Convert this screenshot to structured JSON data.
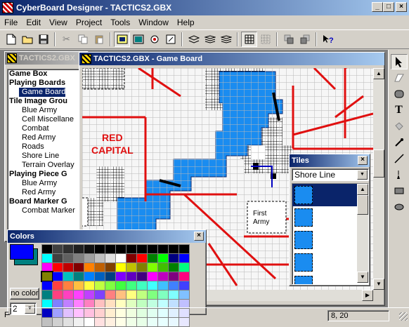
{
  "app": {
    "title": "CyberBoard Designer - TACTICS2.GBX"
  },
  "menu": [
    "File",
    "Edit",
    "View",
    "Project",
    "Tools",
    "Window",
    "Help"
  ],
  "toolbar": {
    "icons": [
      "new-file-icon",
      "open-folder-icon",
      "save-icon",
      "cut-icon",
      "copy-icon",
      "paste-icon",
      "board-view-icon",
      "tile-palette-icon",
      "rotate-icon",
      "edit-icon",
      "layer-1-icon",
      "layer-2-icon",
      "layer-3-icon",
      "grid-icon",
      "dotted-grid-icon",
      "stack-icon",
      "stack-alt-icon",
      "help-pointer-icon"
    ]
  },
  "project_window": {
    "title": "TACTICS2.GBX",
    "tree": [
      {
        "label": "Game Box",
        "level": 0
      },
      {
        "label": "Playing Boards",
        "level": 0
      },
      {
        "label": "Game Board",
        "level": 1,
        "selected": true
      },
      {
        "label": "Tile Image Grou",
        "level": 0
      },
      {
        "label": "Blue Army",
        "level": 1
      },
      {
        "label": "Cell Miscellane",
        "level": 1
      },
      {
        "label": "Combat",
        "level": 1
      },
      {
        "label": "Red Army",
        "level": 1
      },
      {
        "label": "Roads",
        "level": 1
      },
      {
        "label": "Shore Line",
        "level": 1
      },
      {
        "label": "Terrain Overlay",
        "level": 1
      },
      {
        "label": "Playing Piece G",
        "level": 0
      },
      {
        "label": "Blue Army",
        "level": 1
      },
      {
        "label": "Red Army",
        "level": 1
      },
      {
        "label": "Board Marker G",
        "level": 0
      },
      {
        "label": "Combat Marker",
        "level": 1
      }
    ]
  },
  "board_window": {
    "title": "TACTICS2.GBX - Game Board",
    "labels": {
      "red_capital_1": "RED",
      "red_capital_2": "CAPITAL",
      "first_army_1": "First",
      "first_army_2": "Army"
    }
  },
  "tiles_window": {
    "title": "Tiles",
    "selected_group": "Shore Line",
    "tile_count": 5
  },
  "colors_window": {
    "title": "Colors",
    "no_color_label": "no color",
    "line_width": "2",
    "foreground": "#0000ff",
    "background": "#008080",
    "palette": [
      [
        "#000000",
        "#404040",
        "#303030",
        "#202020",
        "#101010",
        "#000000",
        "#000000",
        "#000000",
        "#000000",
        "#000000",
        "#000000",
        "#000000",
        "#000000",
        "#000000"
      ],
      [
        "#00ffff",
        "#404040",
        "#606060",
        "#808080",
        "#a0a0a0",
        "#c0c0c0",
        "#e0e0e0",
        "#ffffff",
        "#800000",
        "#ff0000",
        "#008000",
        "#00ff00",
        "#000080",
        "#0000ff"
      ],
      [
        "#ff00ff",
        "#ff0000",
        "#c00000",
        "#800000",
        "#ff8000",
        "#c06000",
        "#804000",
        "#ffff00",
        "#c0c000",
        "#808000",
        "#80ff00",
        "#40c000",
        "#008000",
        "#00ff80"
      ],
      [
        "#808000",
        "#0000ff",
        "#00c0c0",
        "#008080",
        "#0080ff",
        "#0060c0",
        "#004080",
        "#8000ff",
        "#6000c0",
        "#400080",
        "#ff00ff",
        "#c000c0",
        "#800080",
        "#ff0080"
      ],
      [
        "#0000ff",
        "#ff4040",
        "#ff8040",
        "#ffc040",
        "#ffff40",
        "#c0ff40",
        "#80ff40",
        "#40ff40",
        "#40ff80",
        "#40ffc0",
        "#40ffff",
        "#40c0ff",
        "#4080ff",
        "#4040ff"
      ],
      [
        "#008080",
        "#ff4080",
        "#ff40c0",
        "#ff40ff",
        "#c040ff",
        "#8040ff",
        "#ff8080",
        "#ffc080",
        "#ffff80",
        "#c0ff80",
        "#80ff80",
        "#80ffc0",
        "#80ffff",
        "#80c0ff"
      ],
      [
        "#00ffff",
        "#8080ff",
        "#c080ff",
        "#ff80ff",
        "#ff80c0",
        "#ffc0c0",
        "#ffe0c0",
        "#ffffc0",
        "#e0ffc0",
        "#c0ffc0",
        "#c0ffe0",
        "#c0ffff",
        "#c0e0ff",
        "#c0c0ff"
      ],
      [
        "#0000c0",
        "#a0a0ff",
        "#e0c0ff",
        "#ffc0ff",
        "#ffc0e0",
        "#ffd0d0",
        "#ffeed0",
        "#ffffe0",
        "#f0ffe0",
        "#e0ffe0",
        "#e0fff0",
        "#e0ffff",
        "#e0f0ff",
        "#e0e0ff"
      ],
      [
        "#c0c0c0",
        "#d0d0d0",
        "#e0e0e0",
        "#f0f0f0",
        "#ffffff",
        "#ffe0e0",
        "#fff0e0",
        "#ffffe8",
        "#f0ffe8",
        "#e8ffe8",
        "#e8fff8",
        "#e8ffff",
        "#e8f8ff",
        "#e8e8ff"
      ]
    ]
  },
  "right_tools": [
    "arrow-pointer-icon",
    "eraser-icon",
    "rounded-rect-icon",
    "text-tool-icon",
    "fill-bucket-icon",
    "eyedropper-icon",
    "line-tool-icon",
    "paint-brush-icon",
    "rectangle-tool-icon",
    "ellipse-tool-icon"
  ],
  "status": {
    "left": "F",
    "coords": "8, 20"
  },
  "colors": {
    "water": "#1a8cf0",
    "road": "#e01010",
    "selection": "#0a246a"
  }
}
